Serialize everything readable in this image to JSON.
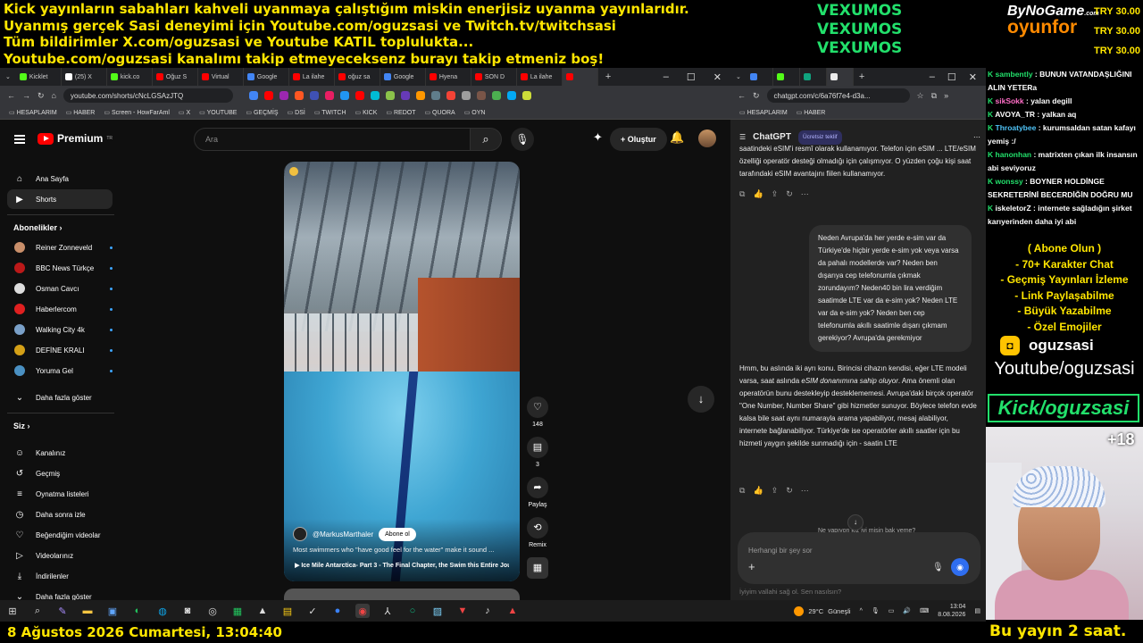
{
  "banner": {
    "line1": "Kick yayınların sabahları kahveli uyanmaya çalıştığım miskin enerjisiz uyanma yayınlarıdır.",
    "line2": "Uyanmış gerçek Sasi deneyimi için Youtube.com/oguzsasi ve Twitch.tv/twitchsasi",
    "line3": "Tüm bildirimler X.com/oguzsasi ve Youtube KATIL toplulukta...",
    "line4": "Youtube.com/oguzsasi kanalımı takip etmeyeceksenz burayı takip etmeniz boş!"
  },
  "sponsor": {
    "lines": [
      "VEXUMOS",
      "VEXUMOS",
      "VEXUMOS"
    ]
  },
  "logo": {
    "top": "ByNoGame",
    "bottom": "oyunfor",
    "com": ".com"
  },
  "tries": [
    "TRY 30.00",
    "TRY 30.00",
    "TRY 30.00"
  ],
  "left_browser": {
    "tabs": [
      {
        "label": "Kicklet",
        "color": "#53fc18"
      },
      {
        "label": "(25) X",
        "color": "#ffffff"
      },
      {
        "label": "kick.co",
        "color": "#53fc18"
      },
      {
        "label": "Oğuz S",
        "color": "#ff0000"
      },
      {
        "label": "Virtual",
        "color": "#ff0000"
      },
      {
        "label": "Google",
        "color": "#4285f4"
      },
      {
        "label": "La ilahe",
        "color": "#ff0000"
      },
      {
        "label": "oğuz sa",
        "color": "#ff0000"
      },
      {
        "label": "Google",
        "color": "#4285f4"
      },
      {
        "label": "Hyena",
        "color": "#ff0000"
      },
      {
        "label": "SON D",
        "color": "#ff0000"
      },
      {
        "label": "La ilahe",
        "color": "#ff0000"
      },
      {
        "label": "",
        "color": "#ff0000"
      }
    ],
    "new_tab": "+",
    "url": "youtube.com/shorts/cNcLGSAzJTQ",
    "bookmarks": [
      "HESAPLARIM",
      "HABER",
      "Screen - HowFarAml",
      "X",
      "YOUTUBE",
      "GEÇMİŞ",
      "DSİ",
      "TWITCH",
      "KICK",
      "REDOT",
      "QUORA",
      "OYN"
    ]
  },
  "youtube": {
    "logo_text": "Premium",
    "logo_tm": "TR",
    "search_placeholder": "Ara",
    "create_label": "+ Oluştur",
    "nav": [
      {
        "label": "Ana Sayfa",
        "icon": "⌂"
      },
      {
        "label": "Shorts",
        "icon": "▶"
      }
    ],
    "subs_header": "Abonelikler  ›",
    "subscriptions": [
      {
        "label": "Reiner Zonneveld",
        "color": "#c98f6a"
      },
      {
        "label": "BBC News Türkçe",
        "color": "#bb1919"
      },
      {
        "label": "Osman Cavcı",
        "color": "#dddddd"
      },
      {
        "label": "Haberlercom",
        "color": "#e02020"
      },
      {
        "label": "Walking City 4k",
        "color": "#7aa0c8"
      },
      {
        "label": "DEFİNE KRALI",
        "color": "#d4a017"
      },
      {
        "label": "Yoruma Gel",
        "color": "#4a90c2"
      }
    ],
    "more_subs": "Daha fazla göster",
    "you_header": "Siz  ›",
    "you_items": [
      {
        "label": "Kanalınız",
        "icon": "☺"
      },
      {
        "label": "Geçmiş",
        "icon": "↺"
      },
      {
        "label": "Oynatma listeleri",
        "icon": "≡"
      },
      {
        "label": "Daha sonra izle",
        "icon": "◷"
      },
      {
        "label": "Beğendiğim videolar",
        "icon": "♡"
      },
      {
        "label": "Videolarınız",
        "icon": "▷"
      },
      {
        "label": "İndirilenler",
        "icon": "⤓"
      },
      {
        "label": "Daha fazla göster",
        "icon": "⌄"
      }
    ],
    "short": {
      "channel": "@MarkusMarthaler",
      "subscribe": "Abone ol",
      "title": "Most swimmers who \"have good feel for the water\" make it sound ...",
      "playlist": "▶ Ice Mile Antarctica- Part 3 - The Final Chapter, the Swim this Entire Jour..."
    },
    "actions": {
      "likes": "148",
      "comments": "3",
      "share": "Paylaş",
      "remix": "Remix"
    }
  },
  "right_browser": {
    "url": "chatgpt.com/c/6a76f7e4-d3a...",
    "bookmarks": [
      "HESAPLARIM",
      "HABER"
    ],
    "chatgpt": {
      "title": "ChatGPT",
      "badge": "Ücretsiz teklif",
      "top_message": "saatindeki eSIM'i resmî olarak kullanamıyor. Telefon için eSIM ... LTE/eSIM özelliği operatör desteği olmadığı için çalışmıyor. O yüzden çoğu kişi saat tarafındaki eSIM avantajını fiilen kullanamıyor.",
      "user_message": "Neden Avrupa'da her yerde e-sim var da Türkiye'de hiçbir yerde e-sim yok veya varsa da pahalı modellerde var? Neden ben dışarıya cep telefonumla çıkmak zorundayım? Neden40 bin lira verdiğim saatimde LTE var da e-sim yok? Neden LTE var da e-sim yok? Neden ben cep telefonumla akıllı saatimle dışarı çıkmam gerekiyor? Avrupa'da gerekmiyor",
      "reply_part1": "Hmm, bu aslında iki ayrı konu. Birincisi cihazın kendisi, eğer LTE modeli varsa, saat aslında ",
      "reply_em": "eSIM donanımına sahip oluyor",
      "reply_part2": ". Ama önemli olan operatörün bunu destekleyip desteklememesi. Avrupa'daki birçok operatör \"One Number, Number Share\" gibi hizmetler sunuyor. Böylece telefon evde kalsa bile saat aynı numarayla arama yapabiliyor, mesaj alabiliyor, internete bağlanabiliyor. Türkiye'de ise operatörler akıllı saatler için bu hizmeti yaygın şekilde sunmadığı için - saatin LTE",
      "peek": "Ne yapıyon kız iyi misin bak yeme?",
      "composer_placeholder": "Herhangi bir şey sor",
      "bottom_hint": "İyiyim vallahi sağ ol. Sen nasılsın?"
    }
  },
  "chat": [
    {
      "user": "sambently",
      "user_color": "#22e06b",
      "text": "BUNUN VATANDAŞLIĞINI ALIN YETERa"
    },
    {
      "user": "sikSokk",
      "user_color": "#ff6ec7",
      "text": "yalan degill"
    },
    {
      "user": "AVOYA_TR",
      "user_color": "#ffffff",
      "text": "yalkan aq"
    },
    {
      "user": "Throatybee",
      "user_color": "#4fc3f7",
      "text": "kurumsaldan satan kafayı yemiş :/"
    },
    {
      "user": "hanonhan",
      "user_color": "#22e06b",
      "text": "matrixten çıkan ilk insansın abi seviyoruz"
    },
    {
      "user": "wonssy",
      "user_color": "#22e06b",
      "text": "BOYNER HOLDİNGE SEKRETERİNİ BECERDİĞİN DOĞRU MU"
    },
    {
      "user": "iskeletorZ",
      "user_color": "#ffffff",
      "text": "internete sağladığın şirket karıyerinden daha iyi abi"
    }
  ],
  "perks": [
    "( Abone Olun )",
    "- 70+ Karakter Chat",
    "- Geçmiş Yayınları İzleme",
    "- Link Paylaşabilme",
    "- Büyük Yazabilme",
    "- Özel Emojiler"
  ],
  "promo": {
    "name": "oguzsasi",
    "youtube": "Youtube/oguzsasi",
    "kick": "Kick/oguzsasi",
    "plus": "+18"
  },
  "taskbar": {
    "weather_temp": "29°C",
    "weather_text": "Güneşli",
    "time": "13:04",
    "date": "8.08.2026"
  },
  "datebar": "8 Ağustos 2026 Cumartesi, 13:04:40",
  "stream_time": "Bu yayın 2 saat."
}
